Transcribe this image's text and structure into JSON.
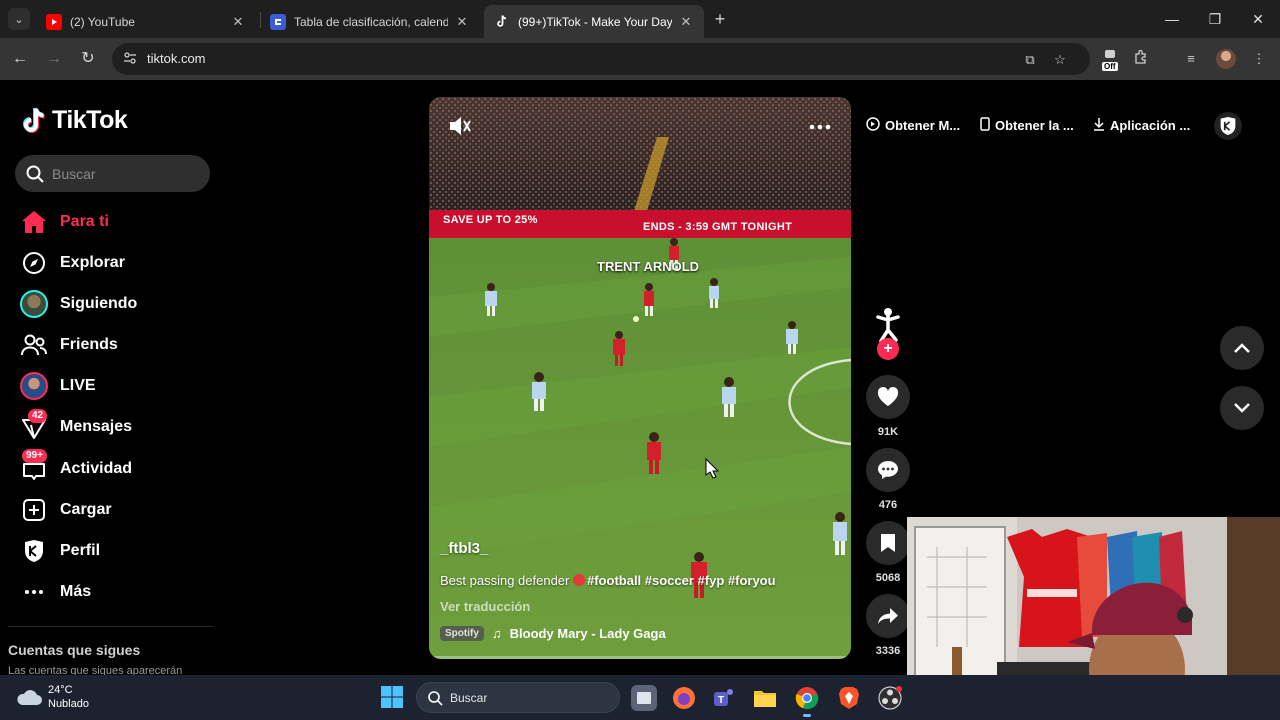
{
  "browser": {
    "tabs": [
      {
        "title": "(2) YouTube",
        "favicon": "youtube-icon",
        "active": false
      },
      {
        "title": "Tabla de clasificación, calendario",
        "favicon": "table-site-icon",
        "active": false
      },
      {
        "title": "(99+)TikTok - Make Your Day",
        "favicon": "tiktok-icon",
        "active": true
      }
    ],
    "address": "tiktok.com",
    "extension_off_label": "Off"
  },
  "tiktok": {
    "logo_text": "TikTok",
    "search_placeholder": "Buscar",
    "nav": [
      {
        "label": "Para ti",
        "icon": "home-icon",
        "active": true
      },
      {
        "label": "Explorar",
        "icon": "compass-icon"
      },
      {
        "label": "Siguiendo",
        "icon": "following-avatar-icon"
      },
      {
        "label": "Friends",
        "icon": "friends-icon"
      },
      {
        "label": "LIVE",
        "icon": "live-avatar-icon"
      },
      {
        "label": "Mensajes",
        "icon": "messages-icon",
        "badge": "42"
      },
      {
        "label": "Actividad",
        "icon": "activity-icon",
        "badge": "99+"
      },
      {
        "label": "Cargar",
        "icon": "upload-icon"
      },
      {
        "label": "Perfil",
        "icon": "profile-icon"
      },
      {
        "label": "Más",
        "icon": "more-icon"
      }
    ],
    "following_title": "Cuentas que sigues",
    "following_subtitle": "Las cuentas que sigues aparecerán",
    "top_links": [
      {
        "label": "Obtener M...",
        "icon": "coin-icon"
      },
      {
        "label": "Obtener la ...",
        "icon": "phone-icon"
      },
      {
        "label": "Aplicación ...",
        "icon": "download-icon"
      }
    ],
    "video": {
      "ad_left": "SAVE UP TO 25%",
      "ad_right": "ENDS - 3:59 GMT TONIGHT",
      "player_label": "TRENT ARNOLD",
      "username": "_ftbl3_",
      "caption_text": "Best passing defender",
      "caption_tags": "#football #soccer #fyp #foryou",
      "translate": "Ver traducción",
      "music_source": "Spotify",
      "music": "Bloody Mary - Lady Gaga",
      "progress": 0.0
    },
    "actions": {
      "likes": "91K",
      "comments": "476",
      "saves": "5068",
      "shares": "3336"
    }
  },
  "taskbar": {
    "temperature": "24°C",
    "condition": "Nublado",
    "search_placeholder": "Buscar"
  }
}
